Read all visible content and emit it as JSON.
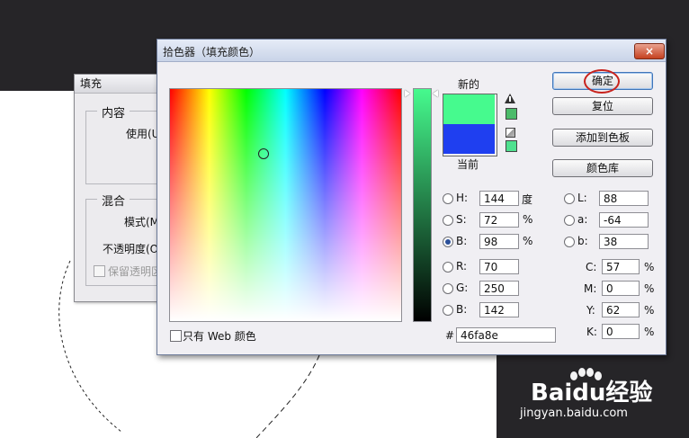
{
  "fill_dialog": {
    "title": "填充",
    "content_group": "内容",
    "use_label": "使用(U",
    "blend_group": "混合",
    "mode_label": "模式(M",
    "opacity_label": "不透明度(O",
    "preserve_label": "保留透明区"
  },
  "picker": {
    "title": "拾色器（填充颜色）",
    "close_label": "×",
    "new_label": "新的",
    "current_label": "当前",
    "new_color": "#46fa8e",
    "current_color": "#1f3ff0",
    "buttons": {
      "ok": "确定",
      "reset": "复位",
      "add_swatch": "添加到色板",
      "libraries": "颜色库"
    },
    "hsb": {
      "h_label": "H:",
      "h_value": "144",
      "h_unit": "度",
      "s_label": "S:",
      "s_value": "72",
      "s_unit": "%",
      "b_label": "B:",
      "b_value": "98",
      "b_unit": "%"
    },
    "rgb": {
      "r_label": "R:",
      "r_value": "70",
      "g_label": "G:",
      "g_value": "250",
      "b_label": "B:",
      "b_value": "142"
    },
    "lab": {
      "l_label": "L:",
      "l_value": "88",
      "a_label": "a:",
      "a_value": "-64",
      "b_label": "b:",
      "b_value": "38"
    },
    "cmyk": {
      "c_label": "C:",
      "c_value": "57",
      "c_unit": "%",
      "m_label": "M:",
      "m_value": "0",
      "m_unit": "%",
      "y_label": "Y:",
      "y_value": "62",
      "y_unit": "%",
      "k_label": "K:",
      "k_value": "0",
      "k_unit": "%"
    },
    "hex_label": "#",
    "hex_value": "46fa8e",
    "web_only_label": "只有 Web 颜色"
  },
  "watermark": {
    "brand": "Baidu经验",
    "url": "jingyan.baidu.com"
  },
  "colors": {
    "ps_dark": "#262528",
    "highlight_ring": "#c8231d",
    "selected_radio": "#2a4f99"
  }
}
